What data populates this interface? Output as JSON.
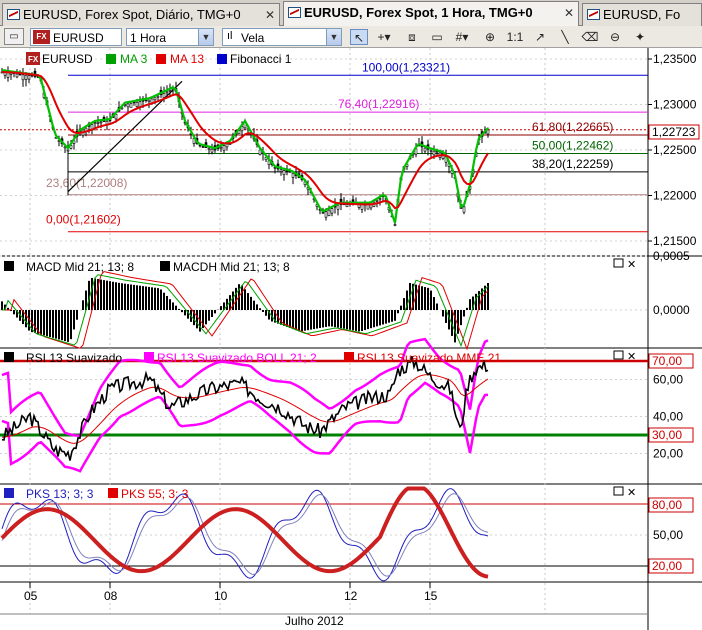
{
  "tabs": [
    {
      "label": "EURUSD, Forex Spot, Diário, TMG+0",
      "close": "✕"
    },
    {
      "label": "EURUSD, Forex Spot, 1 Hora, TMG+0",
      "close": "✕"
    },
    {
      "label": "EURUSD, Fo",
      "close": ""
    }
  ],
  "toolbar": {
    "symbol": "EURUSD",
    "symbol_badge": "FX",
    "period": "1 Hora",
    "chart_type": "Vela",
    "icons": [
      "cursor-icon",
      "crosshair-icon",
      "magnifier-icon",
      "period-sep-icon",
      "grid-icon",
      "zoom-in-icon",
      "scale-icon",
      "line-up-icon",
      "line-down-icon",
      "eraser-icon",
      "zoom-out-icon",
      "settings-icon"
    ],
    "icon_glyphs": [
      "↖",
      "+▾",
      "⧈",
      "▭",
      "#▾",
      "⊕",
      "1:1",
      "↗",
      "╲",
      "⌫",
      "⊖",
      "✦"
    ]
  },
  "price_panel": {
    "fx_badge": "FX",
    "symbol": "EURUSD",
    "ma3_label": "MA 3",
    "ma13_label": "MA 13",
    "fib_label": "Fibonacci 1",
    "current_price": "1,22723",
    "axis_labels": [
      "1,23500",
      "1,23000",
      "1,22500",
      "1,22000",
      "1,21500"
    ],
    "axis_values": [
      1.235,
      1.23,
      1.225,
      1.22,
      1.215
    ],
    "fib_levels": [
      {
        "label": "100,00(1,23321)",
        "value": 1.23321,
        "color": "#0000cc"
      },
      {
        "label": "76,40(1,22916)",
        "value": 1.22916,
        "color": "#e020e0"
      },
      {
        "label": "61,80(1,22665)",
        "value": 1.22665,
        "color": "#8b0000"
      },
      {
        "label": "50,00(1,22462)",
        "value": 1.22462,
        "color": "#006400"
      },
      {
        "label": "38,20(1,22259)",
        "value": 1.22259,
        "color": "#000000"
      },
      {
        "label": "23,60(1,22008)",
        "value": 1.22008,
        "color": "#b08080"
      },
      {
        "label": "0,00(1,21602)",
        "value": 1.21602,
        "color": "#e00000"
      }
    ],
    "colors": {
      "ma3": "#00c000",
      "ma13": "#e00000",
      "candle": "#000000",
      "price_line": "#cc0000"
    }
  },
  "macd_panel": {
    "label1": "MACD Mid  21; 13; 8",
    "label2": "MACDH Mid  21; 13; 8",
    "axis_labels": [
      "0,0005",
      "0,0000"
    ],
    "axis_values": [
      0.0005,
      0.0
    ]
  },
  "rsi_panel": {
    "label1": "RSI 13 Suavizado",
    "label2": "RSI 13 Suavizado BOLL 21; 2",
    "label3": "RSI 13 Suavizado MME 21",
    "axis_labels": [
      "60,00",
      "40,00",
      "20,00"
    ],
    "axis_values": [
      60,
      40,
      20
    ],
    "upper_level": "70,00",
    "upper_value": 70,
    "lower_level": "30,00",
    "lower_value": 30,
    "colors": {
      "rsi": "#000000",
      "boll": "#ff00ff",
      "mme": "#e00000",
      "upper": "#cc0000",
      "lower": "#008000"
    }
  },
  "pks_panel": {
    "label1": "PKS 13; 3; 3",
    "label2": "PKS 55; 3; 3",
    "axis_labels": [
      "50,00"
    ],
    "axis_values": [
      50
    ],
    "upper_level": "80,00",
    "upper_value": 80,
    "lower_level": "20,00",
    "lower_value": 20
  },
  "x_axis": {
    "labels": [
      "05",
      "08",
      "10",
      "12",
      "15"
    ],
    "month_label": "Julho 2012"
  }
}
